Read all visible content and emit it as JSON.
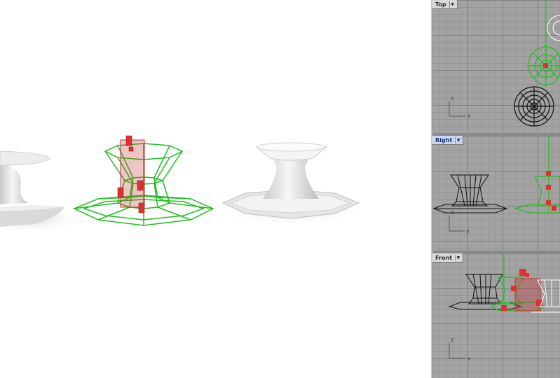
{
  "viewports": {
    "perspective": {
      "label": ""
    },
    "top": {
      "label": "Top",
      "active": false,
      "axis_x": "x",
      "axis_y": "y"
    },
    "right": {
      "label": "Right",
      "active": true,
      "axis_x": "y",
      "axis_y": "z"
    },
    "front": {
      "label": "Front",
      "active": false,
      "axis_x": "x",
      "axis_y": "z"
    }
  },
  "icons": {
    "viewport_menu": "chevron-down-icon"
  },
  "colors": {
    "selection_wire": "#1fbf1f",
    "control_points": "#e03030",
    "gumball_red": "#c23030",
    "gumball_green": "#2aa52a",
    "viewport_bg": "#a3a3a3",
    "grid_major": "#7f7f7f"
  }
}
